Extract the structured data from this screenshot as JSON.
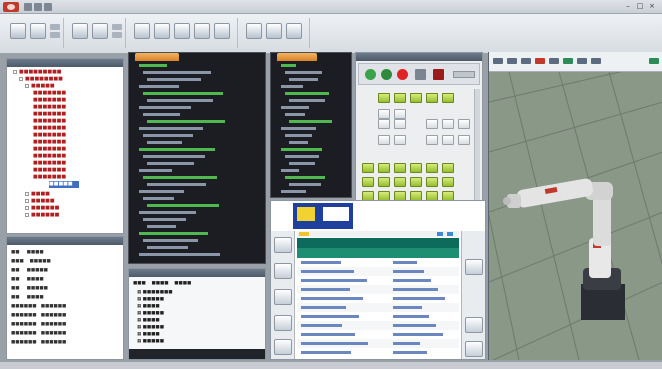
{
  "colors": {
    "accent_orange": "#d9822b",
    "teach_green": "#98bf2e",
    "robot_red": "#c0392b",
    "floor": "#8d9b88"
  },
  "titlebar": {
    "icons": [
      "app-logo-icon",
      "save-icon",
      "undo-icon",
      "redo-icon"
    ],
    "window_controls": [
      "minimize-icon",
      "maximize-icon",
      "close-icon"
    ]
  },
  "teach_pendant": {
    "top_buttons": [
      "play-icon",
      "step-icon",
      "stop-icon",
      "record-icon",
      "emergency-icon"
    ]
  },
  "robot_viewport": {
    "toolbar_icons": [
      "select-icon",
      "move-icon",
      "rotate-icon",
      "zoom-icon",
      "fit-icon",
      "grid-icon",
      "robot-icon",
      "camera-icon"
    ]
  }
}
